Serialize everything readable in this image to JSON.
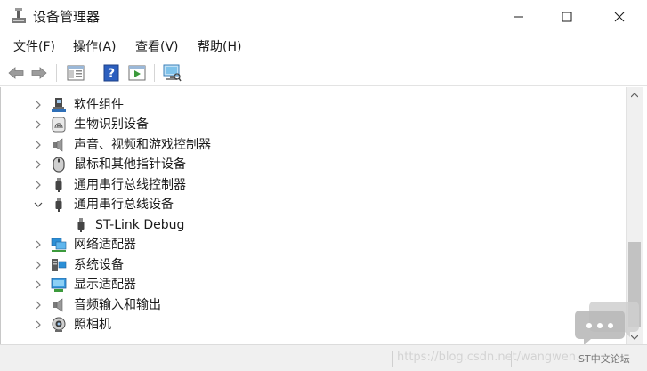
{
  "window": {
    "title": "设备管理器"
  },
  "menu": [
    "文件(F)",
    "操作(A)",
    "查看(V)",
    "帮助(H)"
  ],
  "toolbar": [
    "back-icon",
    "forward-icon",
    "properties-icon",
    "help-icon",
    "update-driver-icon",
    "scan-hardware-icon"
  ],
  "tree": [
    {
      "label": "软件组件",
      "icon": "software-component-icon",
      "expander": "collapsed"
    },
    {
      "label": "生物识别设备",
      "icon": "biometric-icon",
      "expander": "collapsed"
    },
    {
      "label": "声音、视频和游戏控制器",
      "icon": "speaker-icon",
      "expander": "collapsed"
    },
    {
      "label": "鼠标和其他指针设备",
      "icon": "mouse-icon",
      "expander": "collapsed"
    },
    {
      "label": "通用串行总线控制器",
      "icon": "usb-icon",
      "expander": "collapsed"
    },
    {
      "label": "通用串行总线设备",
      "icon": "usb-icon",
      "expander": "expanded"
    },
    {
      "label": "ST-Link Debug",
      "icon": "usb-icon",
      "expander": "none"
    },
    {
      "label": "网络适配器",
      "icon": "network-adapter-icon",
      "expander": "collapsed"
    },
    {
      "label": "系统设备",
      "icon": "system-device-icon",
      "expander": "collapsed"
    },
    {
      "label": "显示适配器",
      "icon": "display-adapter-icon",
      "expander": "collapsed"
    },
    {
      "label": "音频输入和输出",
      "icon": "audio-io-icon",
      "expander": "collapsed"
    },
    {
      "label": "照相机",
      "icon": "camera-icon",
      "expander": "collapsed"
    }
  ],
  "watermark": {
    "url": "https://blog.csdn.net/wangwen…",
    "brand": "ST中文论坛"
  },
  "colors": {
    "usb": "#444444",
    "network": "#2b8fd6",
    "display": "#3b9be0",
    "help": "#2c5fbf"
  }
}
